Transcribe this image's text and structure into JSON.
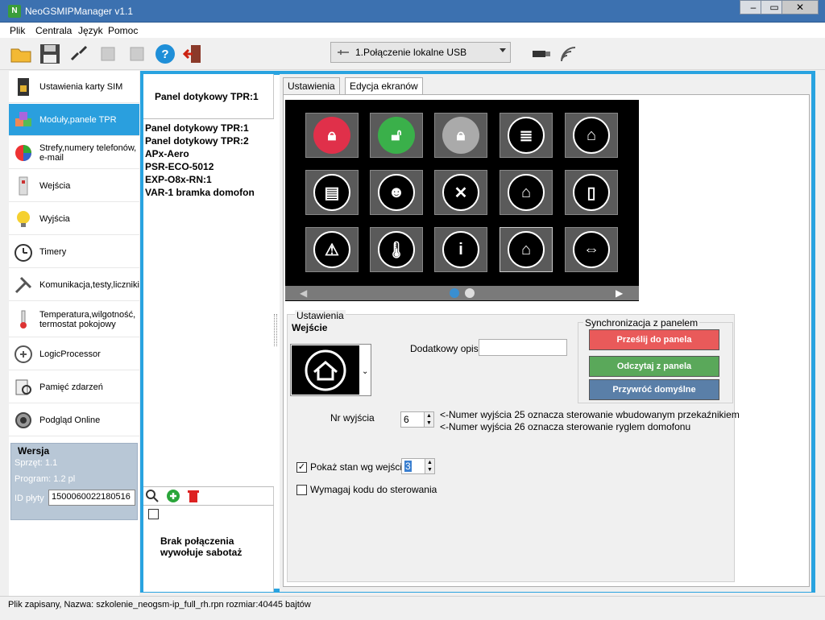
{
  "window": {
    "title": "NeoGSMIPManager v1.1"
  },
  "menu": [
    "Plik",
    "Centrala",
    "Język",
    "Pomoc"
  ],
  "connection": {
    "selected": "1.Połączenie lokalne USB"
  },
  "sidebar": {
    "items": [
      {
        "label": "Ustawienia karty SIM",
        "icon": "sim-card-icon"
      },
      {
        "label": "Moduły,panele TPR",
        "icon": "modules-icon"
      },
      {
        "label": "Strefy,numery telefonów, e-mail",
        "icon": "zones-icon"
      },
      {
        "label": "Wejścia",
        "icon": "inputs-icon"
      },
      {
        "label": "Wyjścia",
        "icon": "bulb-icon"
      },
      {
        "label": "Timery",
        "icon": "clock-icon"
      },
      {
        "label": "Komunikacja,testy,liczniki",
        "icon": "tools-icon"
      },
      {
        "label": "Temperatura,wilgotność, termostat pokojowy",
        "icon": "thermometer-icon"
      },
      {
        "label": "LogicProcessor",
        "icon": "logic-icon"
      },
      {
        "label": "Pamięć zdarzeń",
        "icon": "event-memory-icon"
      },
      {
        "label": "Podgląd Online",
        "icon": "online-view-icon"
      }
    ]
  },
  "version": {
    "heading": "Wersja",
    "hardware": "Sprzęt: 1.1",
    "program": "Program: 1.2 pl",
    "board_id_label": "ID płyty",
    "board_id": "1500060022180516"
  },
  "panel": {
    "title": "Panel dotykowy TPR:1",
    "devices": [
      "Panel dotykowy TPR:1",
      "Panel dotykowy TPR:2",
      "APx-Aero",
      "PSR-ECO-5012",
      "EXP-O8x-RN:1",
      "VAR-1 bramka domofon"
    ],
    "sabotage_label": "Brak połączenia wywołuje sabotaż"
  },
  "tabs": [
    "Ustawienia",
    "Edycja ekranów"
  ],
  "settings": {
    "group_title": "Ustawienia",
    "type_label": "Wejście",
    "extra_desc_label": "Dodatkowy opis",
    "extra_desc_value": "",
    "output_label": "Nr wyjścia",
    "output_value": "6",
    "note1": "<-Numer wyjścia 25 oznacza sterowanie wbudowanym przekaźnikiem",
    "note2": "<-Numer wyjścia 26 oznacza sterowanie ryglem domofonu",
    "show_state_label": "Pokaż stan wg wejścia",
    "show_state_value": "3",
    "require_code_label": "Wymagaj kodu do sterowania"
  },
  "sync": {
    "title": "Synchronizacja z panelem",
    "send": "Prześlij do panela",
    "read": "Odczytaj z panela",
    "restore": "Przywróć domyślne"
  },
  "status": "Plik zapisany, Nazwa: szkolenie_neogsm-ip_full_rh.rpn rozmiar:40445 bajtów"
}
